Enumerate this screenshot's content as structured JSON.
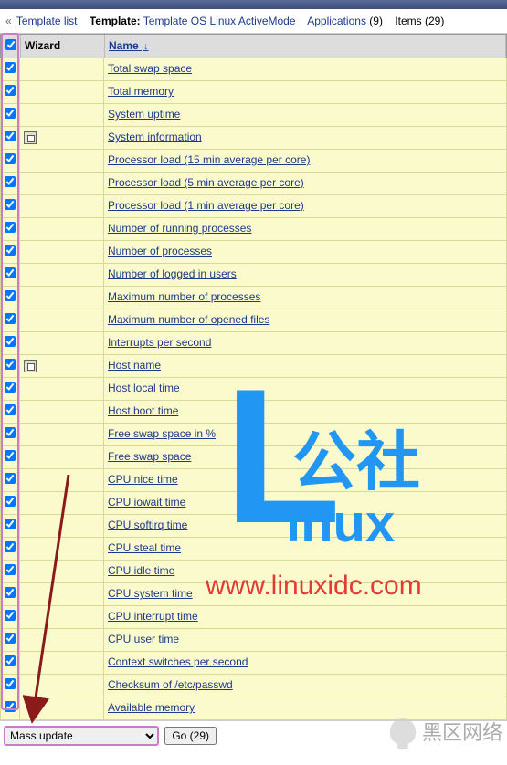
{
  "breadcrumb": {
    "back_symbol": "«",
    "template_list": "Template list",
    "template_label": "Template:",
    "template_name": "Template OS Linux ActiveMode",
    "applications_label": "Applications",
    "applications_count": "(9)",
    "items_label": "Items",
    "items_count": "(29)"
  },
  "headers": {
    "wizard": "Wizard",
    "name": "Name"
  },
  "items": [
    {
      "name": "Total swap space",
      "wizard": false,
      "checked": true
    },
    {
      "name": "Total memory",
      "wizard": false,
      "checked": true
    },
    {
      "name": "System uptime",
      "wizard": false,
      "checked": true
    },
    {
      "name": "System information",
      "wizard": true,
      "checked": true
    },
    {
      "name": "Processor load (15 min average per core)",
      "wizard": false,
      "checked": true
    },
    {
      "name": "Processor load (5 min average per core)",
      "wizard": false,
      "checked": true
    },
    {
      "name": "Processor load (1 min average per core)",
      "wizard": false,
      "checked": true
    },
    {
      "name": "Number of running processes",
      "wizard": false,
      "checked": true
    },
    {
      "name": "Number of processes",
      "wizard": false,
      "checked": true
    },
    {
      "name": "Number of logged in users",
      "wizard": false,
      "checked": true
    },
    {
      "name": "Maximum number of processes",
      "wizard": false,
      "checked": true
    },
    {
      "name": "Maximum number of opened files",
      "wizard": false,
      "checked": true
    },
    {
      "name": "Interrupts per second",
      "wizard": false,
      "checked": true
    },
    {
      "name": "Host name",
      "wizard": true,
      "checked": true
    },
    {
      "name": "Host local time",
      "wizard": false,
      "checked": true
    },
    {
      "name": "Host boot time",
      "wizard": false,
      "checked": true
    },
    {
      "name": "Free swap space in %",
      "wizard": false,
      "checked": true
    },
    {
      "name": "Free swap space",
      "wizard": false,
      "checked": true
    },
    {
      "name": "CPU nice time",
      "wizard": false,
      "checked": true
    },
    {
      "name": "CPU iowait time",
      "wizard": false,
      "checked": true
    },
    {
      "name": "CPU softirq time",
      "wizard": false,
      "checked": true
    },
    {
      "name": "CPU steal time",
      "wizard": false,
      "checked": true
    },
    {
      "name": "CPU idle time",
      "wizard": false,
      "checked": true
    },
    {
      "name": "CPU system time",
      "wizard": false,
      "checked": true
    },
    {
      "name": "CPU interrupt time",
      "wizard": false,
      "checked": true
    },
    {
      "name": "CPU user time",
      "wizard": false,
      "checked": true
    },
    {
      "name": "Context switches per second",
      "wizard": false,
      "checked": true
    },
    {
      "name": "Checksum of /etc/passwd",
      "wizard": false,
      "checked": true
    },
    {
      "name": "Available memory",
      "wizard": false,
      "checked": true
    }
  ],
  "footer": {
    "action": "Mass update",
    "go_label": "Go (29)"
  },
  "watermark": {
    "cn": "公社",
    "inux": "inux",
    "url": "www.linuxidc.com",
    "bottom": "黑区网络"
  }
}
